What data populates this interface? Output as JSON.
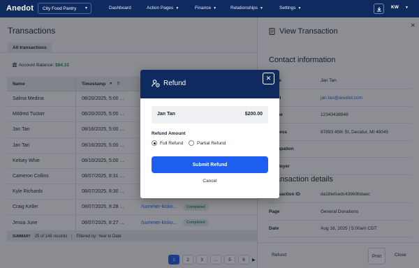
{
  "app": {
    "logo": "Anedot",
    "org": "City Food Pantry",
    "user_initials": "KW"
  },
  "nav": [
    "Dashboard",
    "Action Pages",
    "Finance",
    "Relationships",
    "Settings"
  ],
  "page": {
    "title": "Transactions",
    "tab": "All transactions",
    "balance_label": "Account Balance:",
    "balance_value": "$84.31"
  },
  "table": {
    "headers": [
      "Name",
      "Timestamp"
    ],
    "rows": [
      {
        "name": "Salma Medina",
        "ts": "08/20/2025, 5:00 ...",
        "link": "",
        "status": ""
      },
      {
        "name": "Mildred Tucker",
        "ts": "08/20/2025, 5:00 ...",
        "link": "",
        "status": ""
      },
      {
        "name": "Jan Tan",
        "ts": "08/16/2025, 5:00 ...",
        "link": "",
        "status": ""
      },
      {
        "name": "Jan Tan",
        "ts": "08/16/2025, 5:00 ...",
        "link": "",
        "status": ""
      },
      {
        "name": "Kelsey Whie",
        "ts": "08/10/2025, 5:00 ...",
        "link": "",
        "status": ""
      },
      {
        "name": "Cameron Collins",
        "ts": "08/07/2025, 8:31 ...",
        "link": "",
        "status": ""
      },
      {
        "name": "Kyle Richards",
        "ts": "08/07/2025, 8:30 ...",
        "link": "",
        "status": ""
      },
      {
        "name": "Craig Keller",
        "ts": "08/07/2025, 8:28 ...",
        "link": "/summer-kicko...",
        "status": "Completed"
      },
      {
        "name": "Jessa June",
        "ts": "08/07/2025, 8:27 ...",
        "link": "/summer-kicko...",
        "status": "Completed"
      }
    ]
  },
  "summary": {
    "label": "SUMMARY",
    "records": "25 of 148 records",
    "filter": "Filtered by: Year to Date"
  },
  "pagination": [
    "1",
    "2",
    "3",
    "...",
    "5",
    "6"
  ],
  "panel": {
    "title": "View Transaction",
    "contact_heading": "Contact information",
    "contact": [
      {
        "label": "Name",
        "value": "Jan Tan",
        "link": false
      },
      {
        "label": "Email",
        "value": "jan.tan@anedot.com",
        "link": true
      },
      {
        "label": "Phone",
        "value": "12343438848",
        "link": false
      },
      {
        "label": "Address",
        "value": "87893 45th St, Decatur, MI 49045",
        "link": false
      },
      {
        "label": "Occupation",
        "value": "",
        "link": false
      },
      {
        "label": "Employer",
        "value": "",
        "link": false
      }
    ],
    "details_heading": "Transaction details",
    "details": [
      {
        "label": "Transaction ID",
        "value": "da18lefcedc43969bdaec"
      },
      {
        "label": "Page",
        "value": "General Donations"
      },
      {
        "label": "Date",
        "value": "Aug 16, 2025  |  5:00am CDT"
      }
    ],
    "footer": {
      "refund": "Refund",
      "print": "Print",
      "close": "Close"
    }
  },
  "modal": {
    "title": "Refund",
    "payee_name": "Jan Tan",
    "payee_amount": "$200.00",
    "amount_label": "Refund Amount",
    "option_full": "Full Refund",
    "option_partial": "Partial Refund",
    "submit": "Submit Refund",
    "cancel": "Cancel"
  }
}
